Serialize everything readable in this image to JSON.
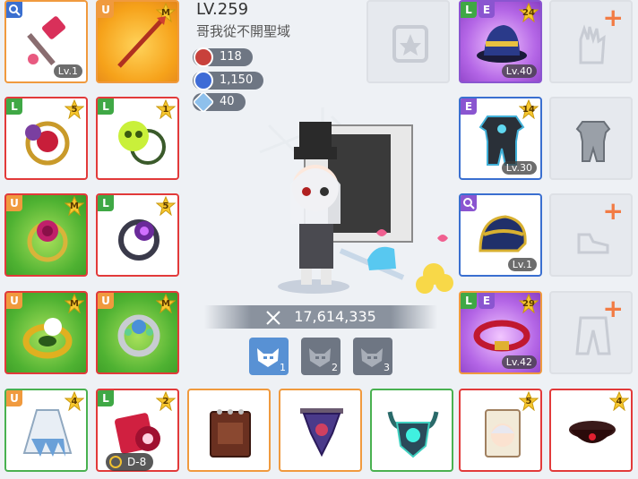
{
  "character": {
    "level_text": "LV.259",
    "name": "哥我從不開聖域"
  },
  "stats": [
    {
      "value": "118",
      "icon": "red-star-force-icon",
      "color": "#c8413b"
    },
    {
      "value": "1,150",
      "icon": "blue-arcane-star-icon",
      "color": "#3e6bd6"
    },
    {
      "value": "40",
      "icon": "crystal-authentic-icon",
      "color": "#6aa3d8"
    }
  ],
  "combat_power": "17,614,335",
  "presets": [
    {
      "label": "1"
    },
    {
      "label": "2"
    },
    {
      "label": "3"
    }
  ],
  "slots": {
    "weapon_search": {
      "badge": "",
      "level": "Lv.1"
    },
    "weapon": {
      "badge": "U",
      "star": "M"
    },
    "ring_red": {
      "badge": "L",
      "star": "5"
    },
    "ring_skull": {
      "badge": "L",
      "star": "1"
    },
    "ring_rose": {
      "badge": "U",
      "star": "M"
    },
    "ring_dark": {
      "badge": "L",
      "star": "5"
    },
    "ring_gold": {
      "badge": "U",
      "star": "M"
    },
    "ring_silver": {
      "badge": "U",
      "star": "M"
    },
    "cape": {
      "badge": "U",
      "star": "4"
    },
    "pocket": {
      "badge": "L",
      "star": "2",
      "potential": "D-8"
    },
    "hat": {
      "badge1": "L",
      "badge2": "E",
      "star": "24",
      "level": "Lv.40"
    },
    "top": {
      "badge": "E",
      "star": "14",
      "level": "Lv.30"
    },
    "shoes": {
      "badge": "",
      "level": "Lv.1"
    },
    "belt": {
      "badge1": "L",
      "badge2": "E",
      "star": "29",
      "level": "Lv.42"
    },
    "badge_slot": {
      "star": "5"
    },
    "headband": {
      "star": "4"
    }
  }
}
